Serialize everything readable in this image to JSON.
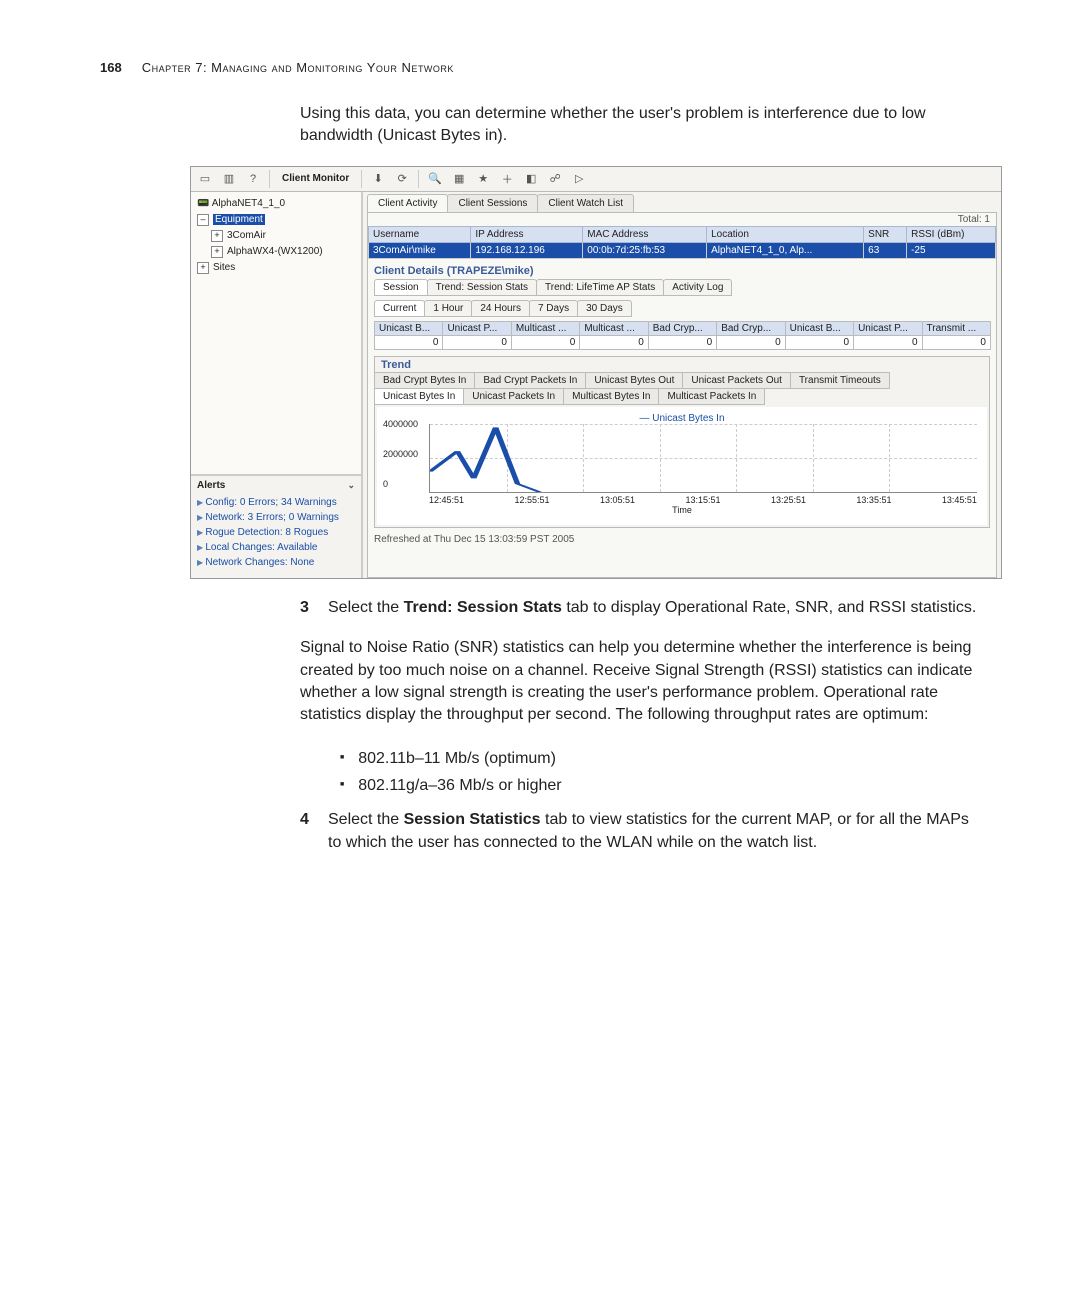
{
  "page_number": "168",
  "chapter_header": "Chapter 7: Managing and Monitoring Your Network",
  "intro_para": "Using this data, you can determine whether the user's problem is interference due to low bandwidth (Unicast Bytes in).",
  "step3_num": "3",
  "step3_text_a": "Select the ",
  "step3_bold": "Trend: Session Stats",
  "step3_text_b": " tab to display Operational Rate, SNR, and RSSI statistics.",
  "para2": "Signal to Noise Ratio (SNR) statistics can help you determine whether the interference is being created by too much noise on a channel. Receive Signal Strength (RSSI) statistics can indicate whether a low signal strength is creating the user's performance problem. Operational rate statistics display the throughput per second. The following throughput rates are optimum:",
  "bullet1": "802.11b–11 Mb/s (optimum)",
  "bullet2": "802.11g/a–36 Mb/s or higher",
  "step4_num": "4",
  "step4_text_a": "Select the ",
  "step4_bold": "Session Statistics",
  "step4_text_b": " tab to view statistics for the current MAP, or for all the MAPs to which the user has connected to the WLAN while on the watch list.",
  "ss": {
    "toolbar_title": "Client Monitor",
    "tree": {
      "root": "AlphaNET4_1_0",
      "equipment": "Equipment",
      "item1": "3ComAir",
      "item2": "AlphaWX4-(WX1200)",
      "sites": "Sites"
    },
    "alerts": {
      "title": "Alerts",
      "rows": [
        "Config: 0 Errors; 34 Warnings",
        "Network: 3 Errors; 0 Warnings",
        "Rogue Detection: 8 Rogues",
        "Local Changes: Available",
        "Network Changes: None"
      ]
    },
    "top_tabs": [
      "Client Activity",
      "Client Sessions",
      "Client Watch List"
    ],
    "top_tab_active": 0,
    "total_label": "Total: 1",
    "columns": [
      "Username",
      "IP Address",
      "MAC Address",
      "Location",
      "SNR",
      "RSSI (dBm)"
    ],
    "row_values": [
      "3ComAir\\mike",
      "192.168.12.196",
      "00:0b:7d:25:fb:53",
      "AlphaNET4_1_0, Alp...",
      "63",
      "-25"
    ],
    "details_title": "Client Details (TRAPEZE\\mike)",
    "detail_tabs": [
      "Session",
      "Trend: Session Stats",
      "Trend: LifeTime AP Stats",
      "Activity Log"
    ],
    "time_tabs": [
      "Current",
      "1 Hour",
      "24 Hours",
      "7 Days",
      "30 Days"
    ],
    "stat_headers": [
      "Unicast B...",
      "Unicast P...",
      "Multicast ...",
      "Multicast ...",
      "Bad Cryp...",
      "Bad Cryp...",
      "Unicast B...",
      "Unicast P...",
      "Transmit ..."
    ],
    "stat_vals": [
      "0",
      "0",
      "0",
      "0",
      "0",
      "0",
      "0",
      "0",
      "0"
    ],
    "trend_title": "Trend",
    "trend_tabs_row1": [
      "Bad Crypt Bytes In",
      "Bad Crypt Packets In",
      "Unicast Bytes Out",
      "Unicast Packets Out",
      "Transmit Timeouts"
    ],
    "trend_tabs_row2": [
      "Unicast Bytes In",
      "Unicast Packets In",
      "Multicast Bytes In",
      "Multicast Packets In"
    ],
    "trend_active_row2": 0,
    "chart_title": "Unicast Bytes In",
    "y_ticks": [
      "4000000",
      "2000000",
      "0"
    ],
    "x_ticks": [
      "12:45:51",
      "12:55:51",
      "13:05:51",
      "13:15:51",
      "13:25:51",
      "13:35:51",
      "13:45:51"
    ],
    "x_axis_title": "Time",
    "status": "Refreshed at Thu Dec 15 13:03:59 PST 2005"
  },
  "chart_data": {
    "type": "line",
    "title": "Unicast Bytes In",
    "xlabel": "Time",
    "ylabel": "",
    "ylim": [
      0,
      4000000
    ],
    "x": [
      "12:45:51",
      "12:55:51",
      "13:05:51",
      "13:15:51",
      "13:25:51",
      "13:35:51",
      "13:45:51"
    ],
    "series": [
      {
        "name": "Unicast Bytes In",
        "values": [
          1200000,
          2400000,
          800000,
          3800000,
          500000,
          0,
          0
        ]
      }
    ]
  }
}
